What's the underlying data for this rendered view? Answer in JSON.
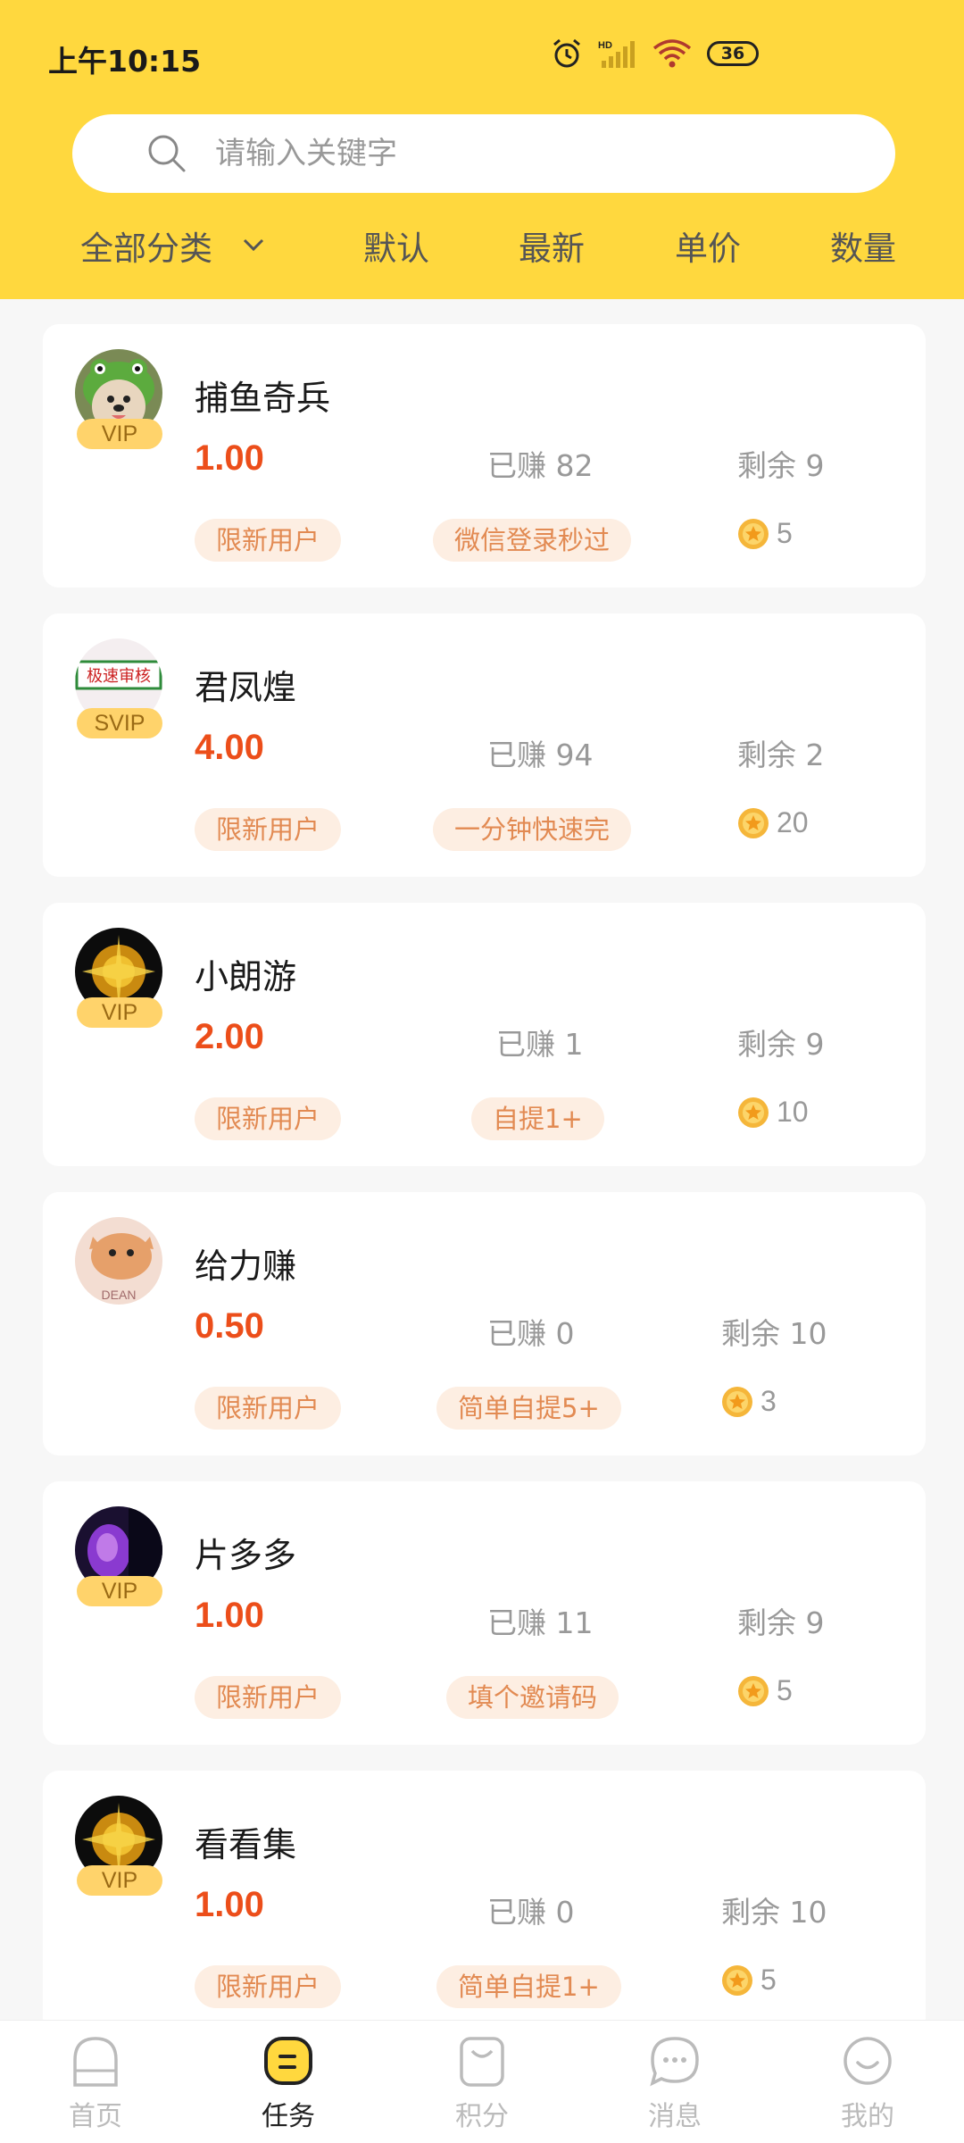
{
  "status": {
    "time": "上午10:15",
    "battery": "36",
    "network": "HD"
  },
  "search": {
    "placeholder": "请输入关键字"
  },
  "filters": {
    "category": "全部分类",
    "default": "默认",
    "newest": "最新",
    "unit_price": "单价",
    "quantity": "数量"
  },
  "tasks": [
    {
      "name": "捕鱼奇兵",
      "badge": "VIP",
      "price": "1.00",
      "earned": "已赚 82",
      "remain": "剩余 9",
      "tag1": "限新用户",
      "tag2": "微信登录秒过",
      "coins": "5"
    },
    {
      "name": "君凤煌",
      "badge": "SVIP",
      "avatar_text": "极速审核",
      "price": "4.00",
      "earned": "已赚 94",
      "remain": "剩余 2",
      "tag1": "限新用户",
      "tag2": "一分钟快速完",
      "coins": "20"
    },
    {
      "name": "小朗游",
      "badge": "VIP",
      "price": "2.00",
      "earned": "已赚 1",
      "remain": "剩余 9",
      "tag1": "限新用户",
      "tag2": "自提1+",
      "coins": "10"
    },
    {
      "name": "给力赚",
      "badge": "",
      "avatar_text": "DEAN",
      "price": "0.50",
      "earned": "已赚 0",
      "remain": "剩余 10",
      "tag1": "限新用户",
      "tag2": "简单自提5+",
      "coins": "3"
    },
    {
      "name": "片多多",
      "badge": "VIP",
      "price": "1.00",
      "earned": "已赚 11",
      "remain": "剩余 9",
      "tag1": "限新用户",
      "tag2": "填个邀请码",
      "coins": "5"
    },
    {
      "name": "看看集",
      "badge": "VIP",
      "price": "1.00",
      "earned": "已赚 0",
      "remain": "剩余 10",
      "tag1": "限新用户",
      "tag2": "简单自提1+",
      "coins": "5"
    }
  ],
  "nav": {
    "home": "首页",
    "tasks": "任务",
    "points": "积分",
    "messages": "消息",
    "mine": "我的",
    "active": "tasks"
  },
  "colors": {
    "header": "#ffd83e",
    "price": "#ec4e1a",
    "tag_bg": "#fdeee2",
    "tag_text": "#e28a52",
    "badge": "#ffd36b"
  }
}
